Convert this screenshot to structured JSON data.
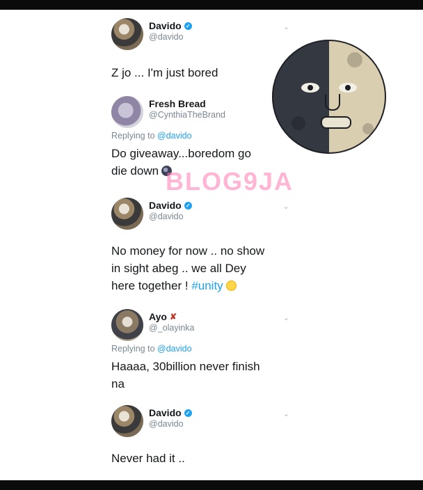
{
  "tweets": [
    {
      "name": "Davido",
      "verified": true,
      "handle": "@davido",
      "text": "Z jo ... I'm just bored"
    },
    {
      "name": "Fresh Bread",
      "verified": false,
      "handle": "@CynthiaTheBrand",
      "replying_label": "Replying to",
      "replying_to": "@davido",
      "text_line1": "Do giveaway...boredom go",
      "text_line2": "die down"
    },
    {
      "name": "Davido",
      "verified": true,
      "handle": "@davido",
      "text_line1": "No money for now .. no show",
      "text_line2": "in sight abeg .. we all Dey",
      "text_line3": "here together !",
      "hashtag": "#unity"
    },
    {
      "name": "Ayo",
      "handle": "@_olayinka",
      "replying_label": "Replying to",
      "replying_to": "@davido",
      "text_line1": "Haaaa, 30billion never finish",
      "text_line2": "na"
    },
    {
      "name": "Davido",
      "verified": true,
      "handle": "@davido",
      "text": "Never had it .."
    }
  ],
  "watermark": "BLOG9JA",
  "colors": {
    "link": "#1da1f2",
    "muted": "#7a8792",
    "watermark": "#ff7ab0"
  },
  "icons": {
    "verified": "verified-badge-icon",
    "menu": "chevron-down-icon"
  }
}
